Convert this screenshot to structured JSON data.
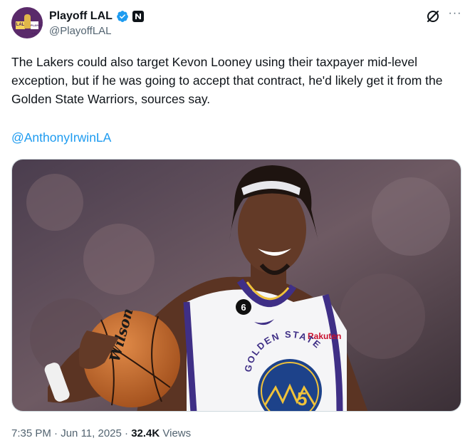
{
  "account": {
    "display_name": "Playoff LAL",
    "handle": "@PlayoffLAL",
    "avatar_badge_left": "LAL",
    "avatar_badge_right": "PLAYOFF LAL"
  },
  "header_icons": {
    "verified": "verified-badge-icon",
    "affiliate": "affiliate-badge-icon",
    "grok": "grok-icon",
    "more": "more-icon",
    "more_glyph": "···"
  },
  "tweet": {
    "text": "The Lakers could also target Kevon Looney using their taxpayer mid-level exception, but if he was going to accept that contract, he'd likely get it from the Golden State Warriors, sources say.",
    "mention": "@AnthonyIrwinLA"
  },
  "media": {
    "jersey_text": "GOLDEN STATE",
    "jersey_number": "5",
    "collar_number": "6",
    "sponsor": "Rakuten",
    "ball_brand": "Wilson"
  },
  "meta": {
    "time": "7:35 PM",
    "separator": " · ",
    "date": "Jun 11, 2025",
    "views_count": "32.4K",
    "views_label": " Views"
  },
  "colors": {
    "link": "#1d9bf0",
    "verified": "#1d9bf0",
    "text": "#0f1419",
    "secondary": "#536471"
  }
}
